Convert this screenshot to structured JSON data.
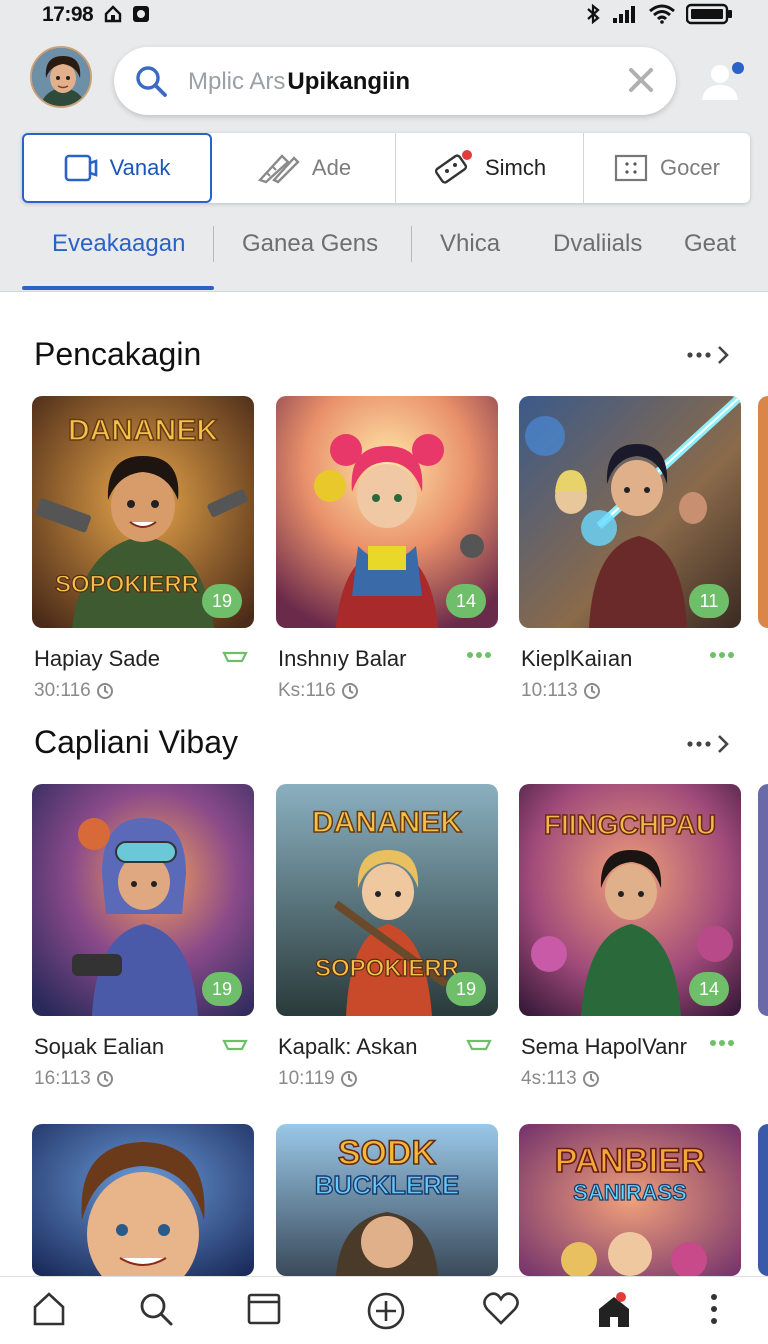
{
  "status": {
    "time": "17:98"
  },
  "search": {
    "placeholder_prefix": "Mplic Ars",
    "query": "Upikangiin"
  },
  "segments": [
    {
      "label": "Vanak",
      "icon": "tablet-icon"
    },
    {
      "label": "Ade",
      "icon": "pencil-ruler-icon"
    },
    {
      "label": "Simch",
      "icon": "controller-icon"
    },
    {
      "label": "Gocer",
      "icon": "grid-icon"
    }
  ],
  "tabs": [
    "Eveakaagan",
    "Ganea Gens",
    "Vhica",
    "Dvaliials",
    "Geat"
  ],
  "sections": [
    {
      "title": "Pencakagin",
      "cards": [
        {
          "title": "Hapiay Sade",
          "meta": "30:116",
          "badge": "19",
          "art_title": "DANANEK",
          "art_sub": "SOPOKIERR"
        },
        {
          "title": "Inshnıy Balar",
          "meta": "Ks:116",
          "badge": "14"
        },
        {
          "title": "KieplKaiıan",
          "meta": "10:113",
          "badge": "11"
        }
      ]
    },
    {
      "title": "Capliani Vibay",
      "cards": [
        {
          "title": "Soµak Ealian",
          "meta": "16:113",
          "badge": "19"
        },
        {
          "title": "Kapalk: Askan",
          "meta": "10:119",
          "badge": "19",
          "art_title": "DANANEK",
          "art_sub": "SOPOKIERR"
        },
        {
          "title": "Sema HapolVanr",
          "meta": "4s:113",
          "badge": "14",
          "art_title": "FIINGCHPAU"
        }
      ]
    },
    {
      "cards": [
        {
          "art_title": ""
        },
        {
          "art_title": "SODK",
          "art_sub": "BUCKLERE"
        },
        {
          "art_title": "PANBIER",
          "art_sub": "SANIRASS"
        }
      ]
    }
  ],
  "colors": {
    "accent": "#2a63c7",
    "badge": "#6fbf6a",
    "header_bg": "#e9eaec"
  }
}
